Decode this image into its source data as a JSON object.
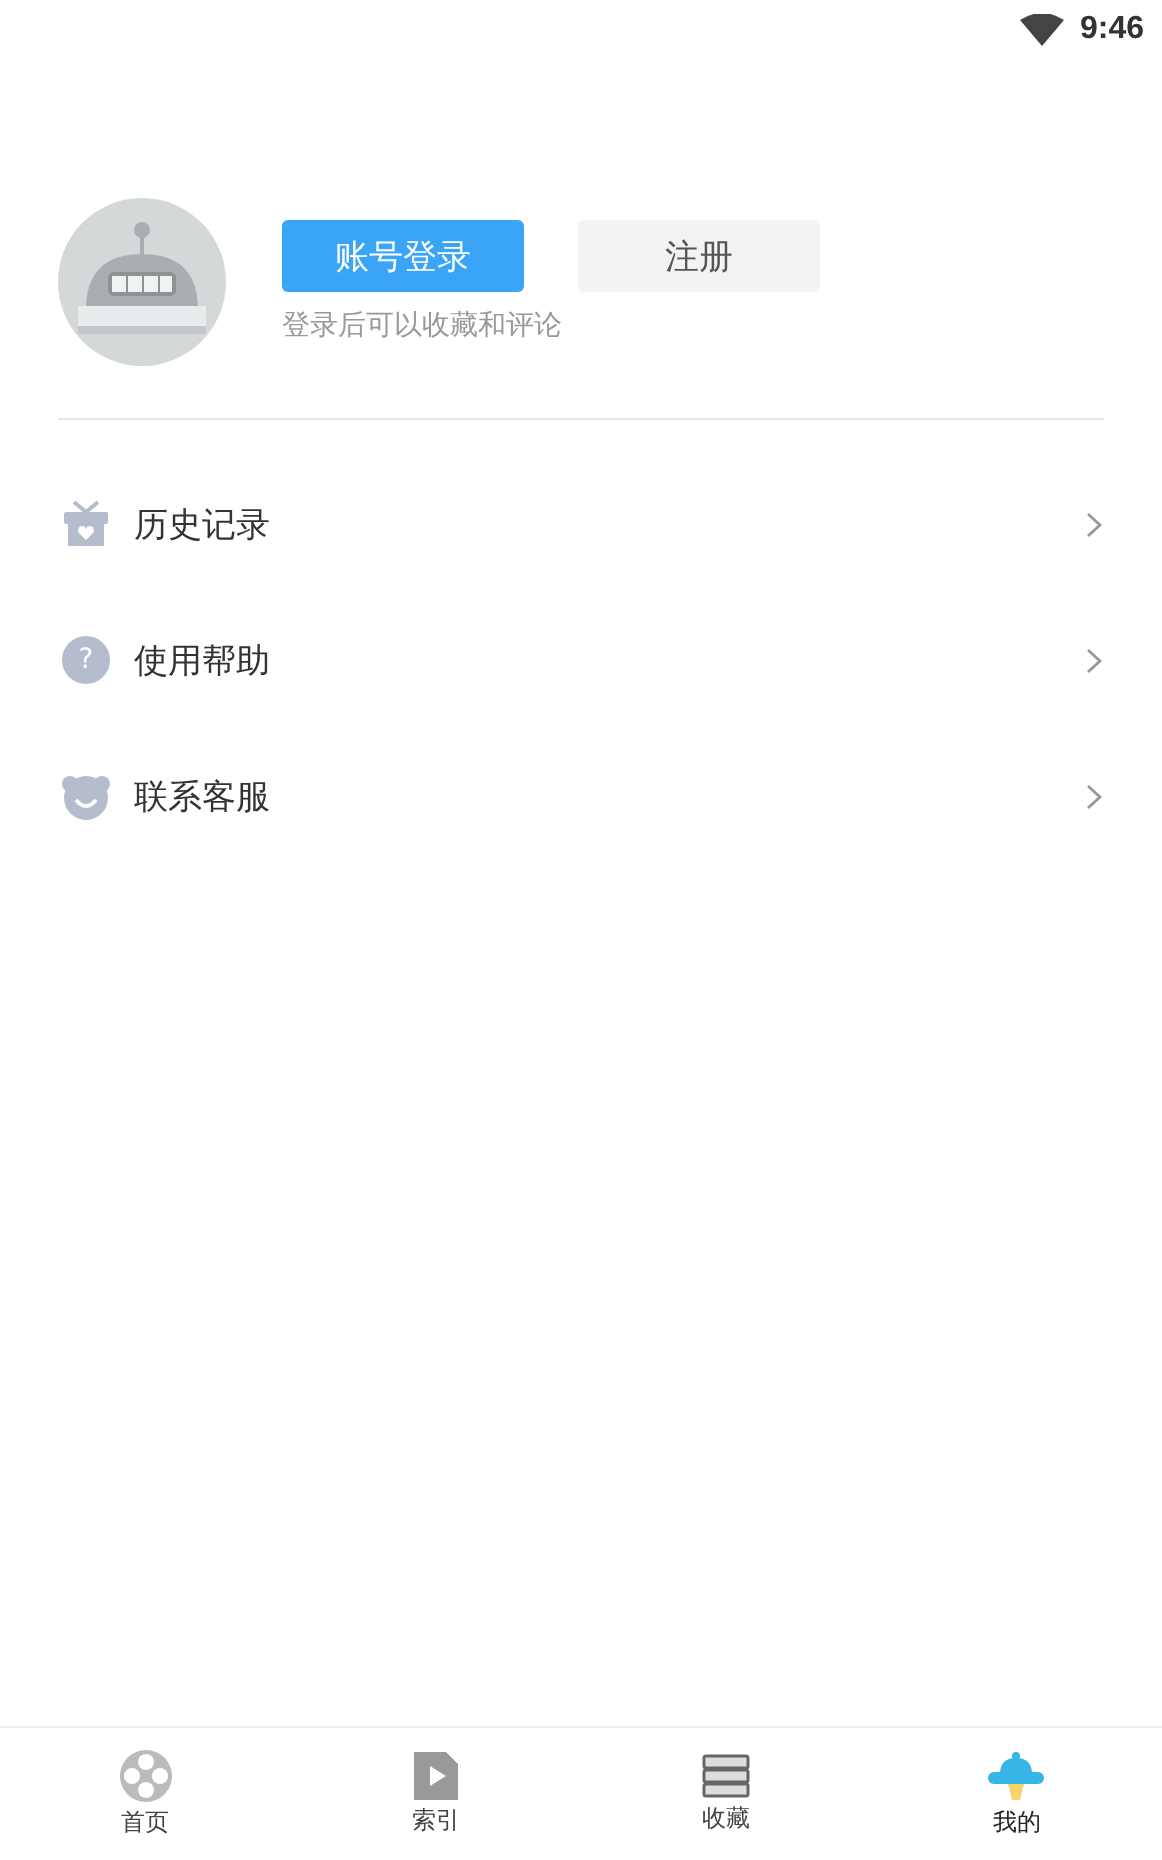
{
  "status_bar": {
    "time": "9:46"
  },
  "profile": {
    "login_button": "账号登录",
    "register_button": "注册",
    "hint": "登录后可以收藏和评论"
  },
  "menu": [
    {
      "kind": "history",
      "label": "历史记录"
    },
    {
      "kind": "help",
      "label": "使用帮助",
      "icon_text": "?"
    },
    {
      "kind": "service",
      "label": "联系客服"
    }
  ],
  "nav": [
    {
      "kind": "home",
      "label": "首页",
      "selected": false
    },
    {
      "kind": "index",
      "label": "索引",
      "selected": false
    },
    {
      "kind": "favorites",
      "label": "收藏",
      "selected": false
    },
    {
      "kind": "mine",
      "label": "我的",
      "selected": true
    }
  ]
}
